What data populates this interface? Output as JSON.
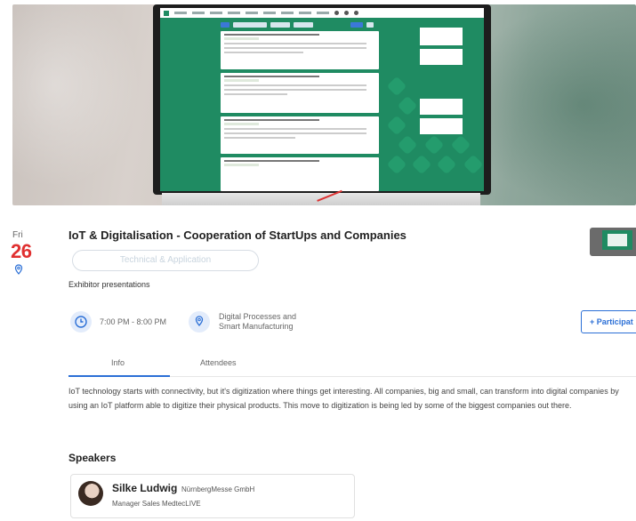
{
  "date": {
    "weekday": "Fri",
    "day": "26"
  },
  "session": {
    "title": "IoT & Digitalisation - Cooperation of StartUps and Companies",
    "tag": "Technical & Application",
    "category": "Exhibitor presentations",
    "time": "7:00 PM - 8:00 PM",
    "location_line1": "Digital Processes and",
    "location_line2": "Smart Manufacturing",
    "participate_label": "+ Participat"
  },
  "tabs": [
    {
      "label": "Info",
      "active": true
    },
    {
      "label": "Attendees",
      "active": false
    }
  ],
  "description": "IoT technology starts with connectivity, but it's digitization where things get interesting. All companies, big and small, can transform into digital companies by using an IoT platform able to digitize their physical products. This move to digitization is being led by some of the biggest companies out there.",
  "speakers_heading": "Speakers",
  "speakers": [
    {
      "name": "Silke Ludwig",
      "company": "NürnbergMesse GmbH",
      "role": "Manager Sales MedtecLIVE"
    }
  ],
  "colors": {
    "accent": "#2b6fd6",
    "date": "#e03030",
    "screen_green": "#1f8b62"
  },
  "icons": [
    "location-pin-icon",
    "clock-icon",
    "location-icon"
  ]
}
